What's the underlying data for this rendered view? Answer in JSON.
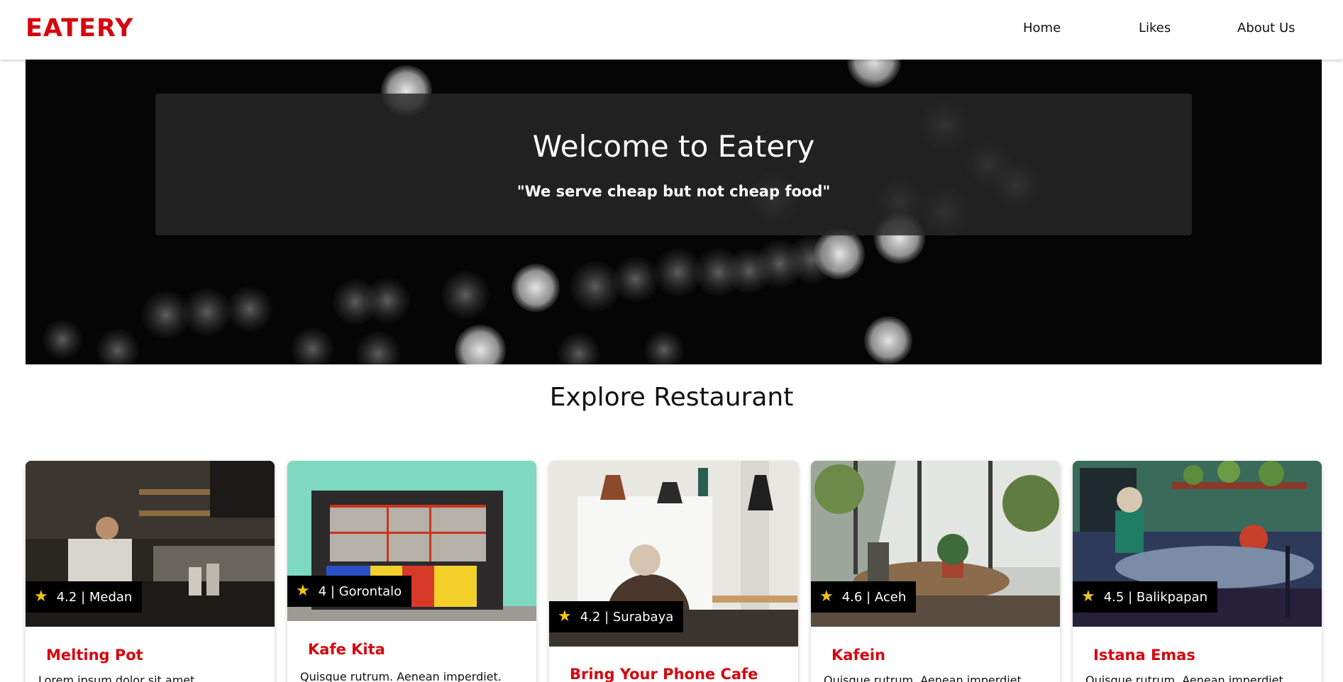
{
  "brand": {
    "name": "EATERY",
    "color": "#d6060f"
  },
  "nav": {
    "items": [
      "Home",
      "Likes",
      "About Us"
    ]
  },
  "hero": {
    "title": "Welcome to Eatery",
    "subtitle": "\"We serve cheap but not cheap food\""
  },
  "section": {
    "title": "Explore Restaurant"
  },
  "restaurants": [
    {
      "rating": "4.2",
      "city": "Medan",
      "rating_text": "4.2 | Medan",
      "name": "Melting Pot",
      "description": "Lorem ipsum dolor sit amet"
    },
    {
      "rating": "4",
      "city": "Gorontalo",
      "rating_text": "4 | Gorontalo",
      "name": "Kafe Kita",
      "description": "Quisque rutrum. Aenean imperdiet."
    },
    {
      "rating": "4.2",
      "city": "Surabaya",
      "rating_text": "4.2 | Surabaya",
      "name": "Bring Your Phone Cafe",
      "description": ""
    },
    {
      "rating": "4.6",
      "city": "Aceh",
      "rating_text": "4.6 | Aceh",
      "name": "Kafein",
      "description": "Quisque rutrum. Aenean imperdiet."
    },
    {
      "rating": "4.5",
      "city": "Balikpapan",
      "rating_text": "4.5 | Balikpapan",
      "name": "Istana Emas",
      "description": "Quisque rutrum. Aenean imperdiet."
    }
  ],
  "colors": {
    "accent": "#d6060f",
    "star": "#f2c419",
    "rating_bg": "#000000"
  },
  "icons": {
    "rating": "star-icon"
  }
}
